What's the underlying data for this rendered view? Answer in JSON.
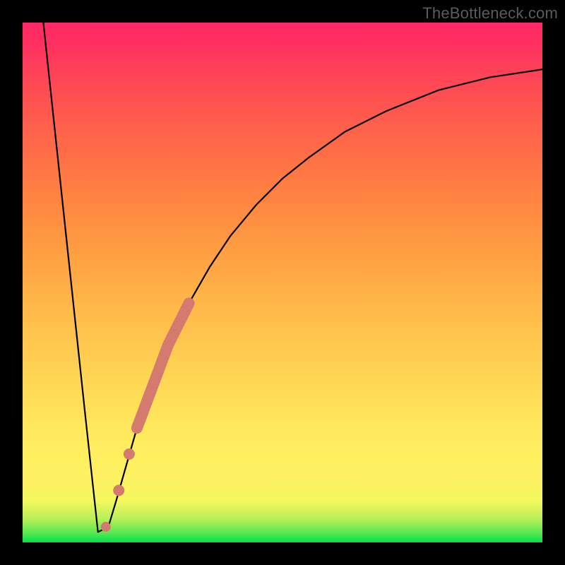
{
  "watermark": "TheBottleneck.com",
  "chart_data": {
    "type": "line",
    "title": "",
    "xlabel": "",
    "ylabel": "",
    "xlim": [
      0,
      100
    ],
    "ylim": [
      0,
      100
    ],
    "grid": false,
    "background": "heat-gradient",
    "series": [
      {
        "name": "bottleneck-curve",
        "description": "V-shaped curve: steep linear drop on the left, sharp minimum near x≈14, then asymptotically rising curve toward the right",
        "x": [
          4,
          12,
          14.5,
          16.5,
          18,
          20,
          22,
          25,
          28,
          32,
          36,
          40,
          45,
          50,
          55,
          62,
          70,
          80,
          90,
          100
        ],
        "y": [
          100,
          25,
          2,
          3,
          8,
          15,
          22,
          30,
          38,
          46,
          53,
          59,
          65,
          70,
          74,
          79,
          83,
          87,
          89.5,
          91
        ]
      }
    ],
    "points": [
      {
        "name": "highlighted-range-top",
        "description": "thick salmon/coral segment along the rising part of the curve",
        "x_range": [
          22,
          32
        ],
        "y_range": [
          22,
          48
        ]
      },
      {
        "name": "highlighted-dot-mid",
        "x": 20.5,
        "y": 17
      },
      {
        "name": "highlighted-dot-low",
        "x": 18.5,
        "y": 10
      },
      {
        "name": "highlighted-dot-bottom",
        "x": 16,
        "y": 3
      }
    ]
  }
}
